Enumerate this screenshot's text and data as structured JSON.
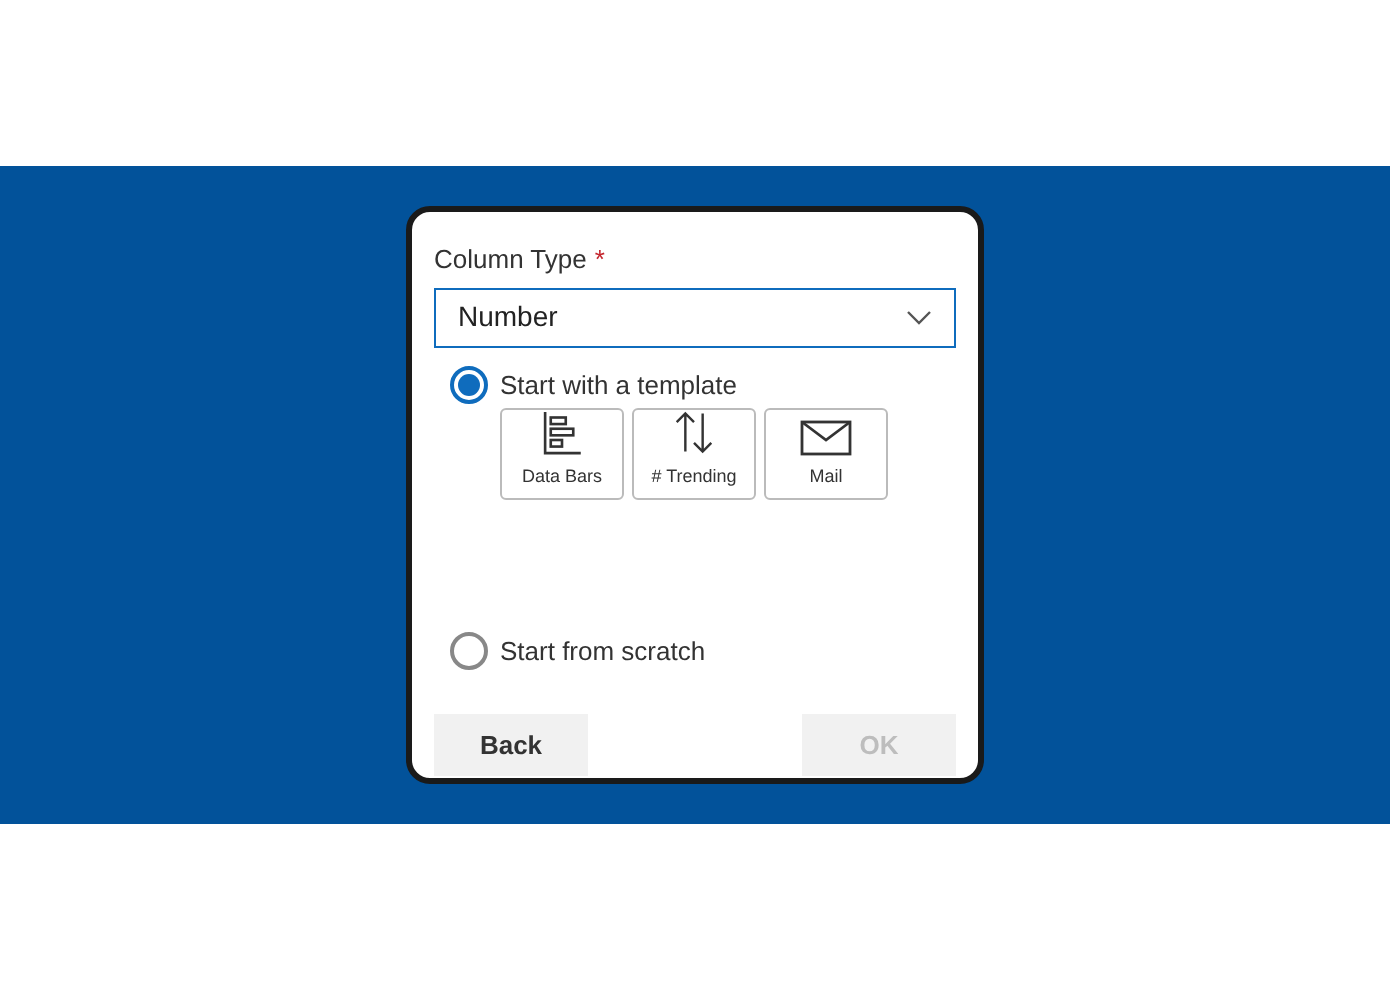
{
  "field": {
    "label": "Column Type",
    "required_mark": "*",
    "value": "Number"
  },
  "options": [
    {
      "label": "Start with a template",
      "selected": true,
      "templates": [
        {
          "kind": "bars",
          "label": "Data Bars"
        },
        {
          "kind": "arrows",
          "label": "# Trending"
        },
        {
          "kind": "mail",
          "label": "Mail"
        }
      ]
    },
    {
      "label": "Start from scratch",
      "selected": false
    }
  ],
  "buttons": [
    {
      "label": "Back",
      "disabled": false
    },
    {
      "label": "OK",
      "disabled": true
    }
  ]
}
